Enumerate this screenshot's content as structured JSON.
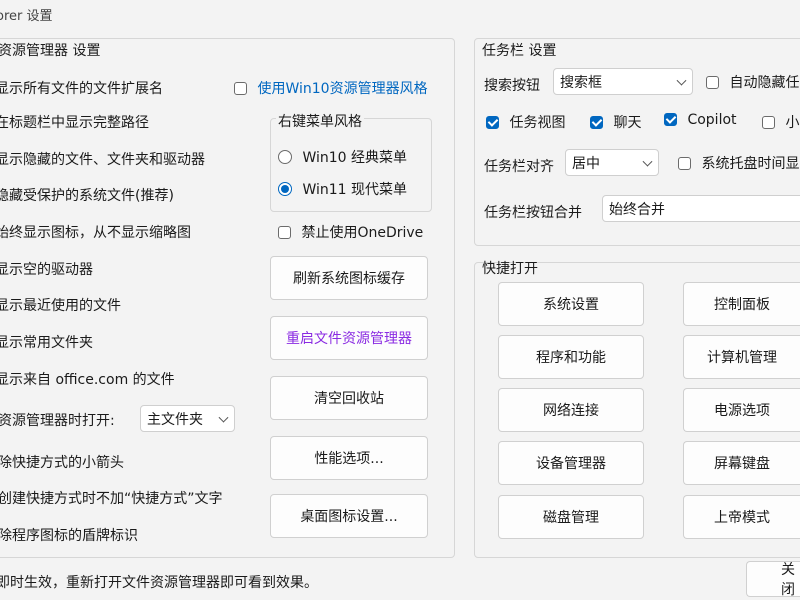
{
  "window": {
    "title": "orer 设置"
  },
  "explorer": {
    "title": "资源管理器 设置",
    "items": [
      "显示所有文件的文件扩展名",
      "在标题栏中显示完整路径",
      "显示隐藏的文件、文件夹和驱动器",
      "隐藏受保护的系统文件(推荐)",
      "始终显示图标，从不显示缩略图",
      "显示空的驱动器",
      "显示最近使用的文件",
      "显示常用文件夹",
      "显示来自 office.com 的文件"
    ],
    "open_label": "资源管理器时打开:",
    "open_value": "主文件夹",
    "items2": [
      "除快捷方式的小箭头",
      "创建快捷方式时不加“快捷方式”文字",
      "除程序图标的盾牌标识"
    ],
    "win10_style": "使用Win10资源管理器风格",
    "context_menu": {
      "title": "右键菜单风格",
      "option1": "Win10 经典菜单",
      "option2": "Win11 现代菜单"
    },
    "disable_onedrive": "禁止使用OneDrive",
    "buttons": [
      "刷新系统图标缓存",
      "重启文件资源管理器",
      "清空回收站",
      "性能选项...",
      "桌面图标设置..."
    ]
  },
  "taskbar": {
    "title": "任务栏 设置",
    "search_label": "搜索按钮",
    "search_value": "搜索框",
    "auto_hide": "自动隐藏任",
    "task_view": "任务视图",
    "chat": "聊天",
    "copilot": "Copilot",
    "small": "小",
    "align_label": "任务栏对齐",
    "align_value": "居中",
    "tray_time": "系统托盘时间显",
    "combine_label": "任务栏按钮合并",
    "combine_value": "始终合并"
  },
  "quick": {
    "title": "快捷打开",
    "left": [
      "系统设置",
      "程序和功能",
      "网络连接",
      "设备管理器",
      "磁盘管理"
    ],
    "right": [
      "控制面板",
      "计算机管理",
      "电源选项",
      "屏幕键盘",
      "上帝模式"
    ]
  },
  "footer": {
    "note": "即时生效，重新打开文件资源管理器即可看到效果。",
    "close": "关闭"
  },
  "colors": {
    "accent": "#0067c0",
    "purple_text": "#8a2be2"
  }
}
